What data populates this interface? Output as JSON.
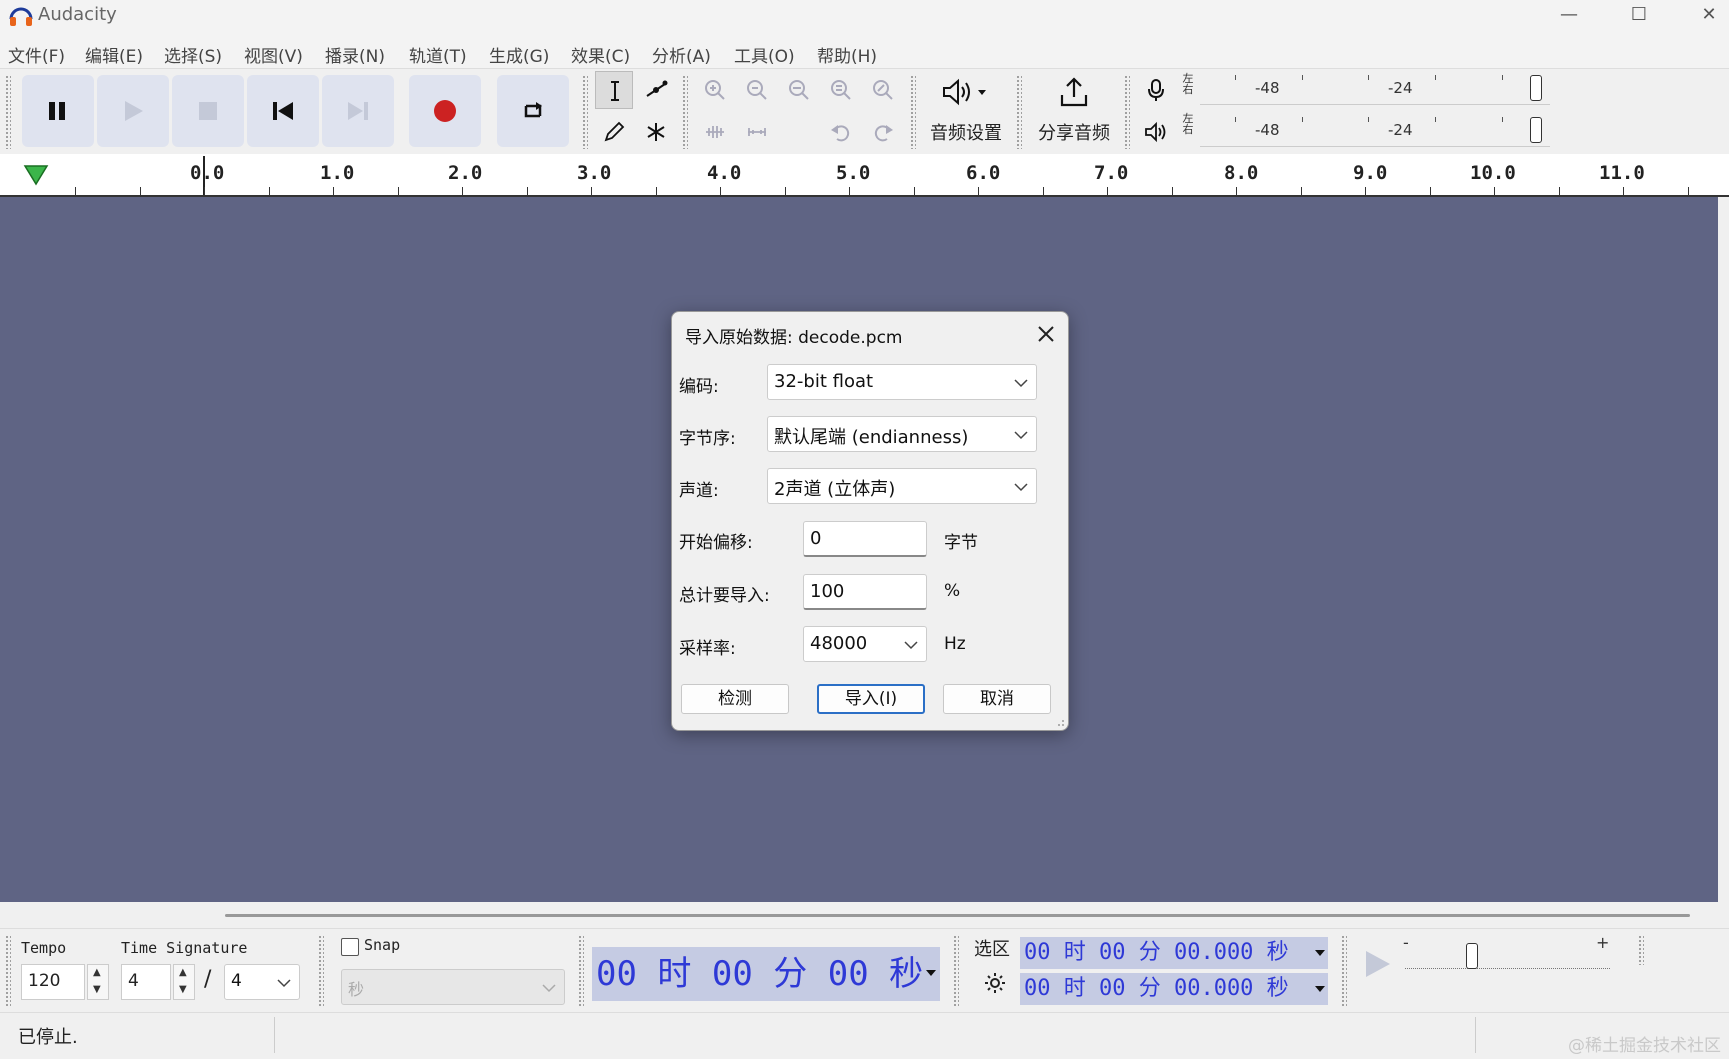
{
  "window": {
    "title": "Audacity"
  },
  "menu": [
    {
      "label": "文件(F)"
    },
    {
      "label": "编辑(E)"
    },
    {
      "label": "选择(S)"
    },
    {
      "label": "视图(V)"
    },
    {
      "label": "播录(N)"
    },
    {
      "label": "轨道(T)"
    },
    {
      "label": "生成(G)"
    },
    {
      "label": "效果(C)"
    },
    {
      "label": "分析(A)"
    },
    {
      "label": "工具(O)"
    },
    {
      "label": "帮助(H)"
    }
  ],
  "toolbar": {
    "audio_setup_label": "音频设置",
    "share_audio_label": "分享音频",
    "meter": {
      "left": "左",
      "right": "右",
      "scale_a": "-48",
      "scale_b": "-24"
    }
  },
  "ruler": {
    "ticks": [
      "0.0",
      "1.0",
      "2.0",
      "3.0",
      "4.0",
      "5.0",
      "6.0",
      "7.0",
      "8.0",
      "9.0",
      "10.0",
      "11.0"
    ]
  },
  "dialog": {
    "title": "导入原始数据: decode.pcm",
    "encoding_label": "编码:",
    "encoding_value": "32-bit float",
    "byte_order_label": "字节序:",
    "byte_order_value": "默认尾端 (endianness)",
    "channels_label": "声道:",
    "channels_value": "2声道 (立体声)",
    "start_offset_label": "开始偏移:",
    "start_offset_value": "0",
    "start_offset_unit": "字节",
    "amount_label": "总计要导入:",
    "amount_value": "100",
    "amount_unit": "%",
    "sample_rate_label": "采样率:",
    "sample_rate_value": "48000",
    "sample_rate_unit": "Hz",
    "detect_button": "检测",
    "import_button": "导入(I)",
    "cancel_button": "取消"
  },
  "bottom": {
    "tempo_label": "Tempo",
    "tempo_value": "120",
    "time_signature_label": "Time Signature",
    "ts_numerator": "4",
    "ts_slash": "/",
    "ts_denominator": "4",
    "snap_label": "Snap",
    "snap_unit": "秒",
    "time_display": "00 时 00 分 00 秒",
    "selection_label": "选区",
    "selection_start": "00 时 00 分 00.000 秒",
    "selection_end": "00 时 00 分 00.000 秒",
    "play_speed_minus": "-",
    "play_speed_plus": "+"
  },
  "status": {
    "text": "已停止.",
    "watermark": "@稀土掘金技术社区"
  },
  "colors": {
    "workspace": "#5f6484",
    "time_display_bg": "#c5cbe3",
    "time_display_fg": "#2e39d6",
    "record_red": "#cc2222"
  }
}
